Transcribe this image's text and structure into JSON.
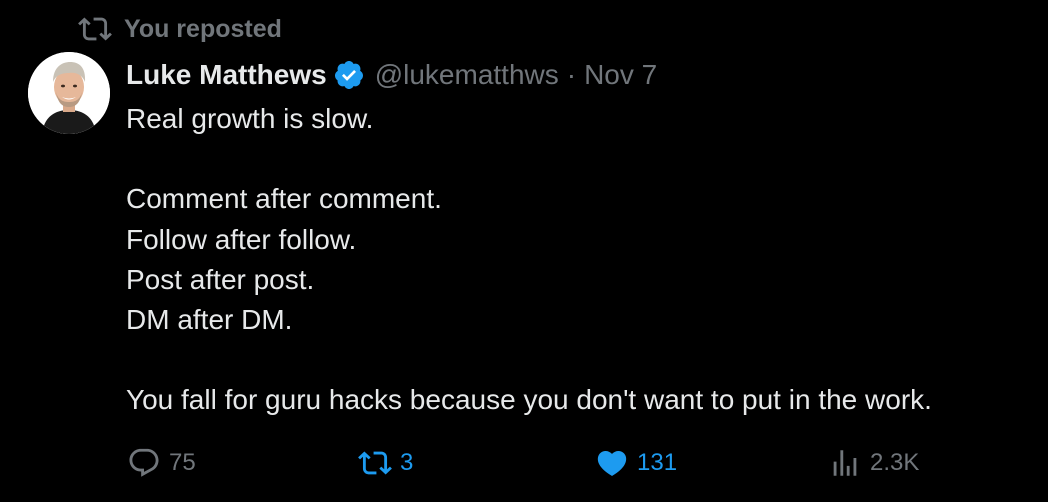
{
  "social_context": {
    "label": "You reposted"
  },
  "author": {
    "name": "Luke Matthews",
    "handle": "@lukematthws",
    "separator": "·",
    "date": "Nov 7",
    "verified": true
  },
  "tweet": {
    "lines": [
      "Real growth is slow.",
      "",
      "Comment after comment.",
      "Follow after follow.",
      "Post after post.",
      "DM after DM.",
      "",
      "You fall for guru hacks because you don't want to put in the work."
    ]
  },
  "actions": {
    "reply": {
      "icon": "reply-icon",
      "count": "75"
    },
    "repost": {
      "icon": "repost-icon",
      "count": "3",
      "active": true
    },
    "like": {
      "icon": "heart-icon",
      "count": "131",
      "active": true
    },
    "views": {
      "icon": "views-icon",
      "count": "2.3K"
    }
  },
  "colors": {
    "background": "#000000",
    "text": "#e7e9ea",
    "muted": "#71767b",
    "accent": "#1d9bf0"
  }
}
